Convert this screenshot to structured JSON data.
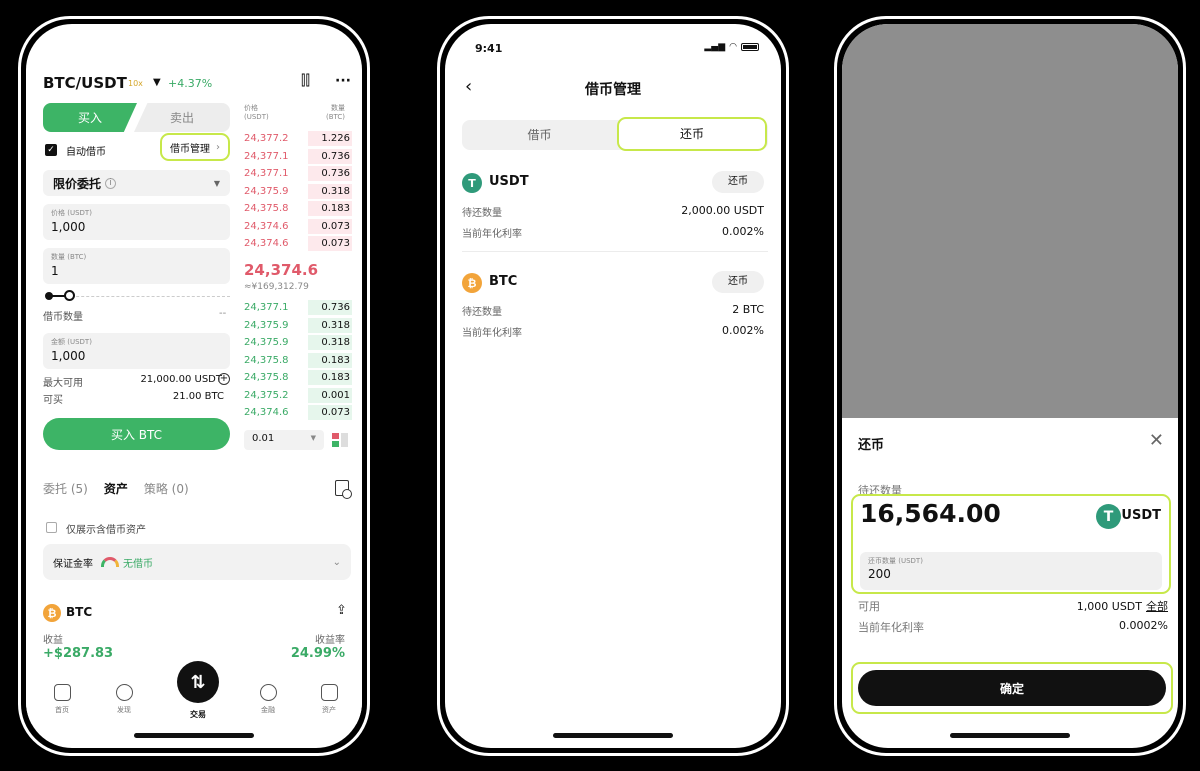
{
  "phone1": {
    "pair": "BTC/USDT",
    "leverage_badge": "10x",
    "change": "+4.37%",
    "buy_tab": "买入",
    "sell_tab": "卖出",
    "auto_borrow": "自动借币",
    "borrow_manage": "借币管理",
    "order_type": "限价委托",
    "price_label": "价格 (USDT)",
    "price_value": "1,000",
    "qty_label": "数量 (BTC)",
    "qty_value": "1",
    "borrow_qty": "借币数量",
    "borrow_qty_value": "--",
    "total_label": "金额 (USDT)",
    "total_value": "1,000",
    "max_avail_label": "最大可用",
    "max_avail_value": "21,000.00 USDT",
    "buyable_label": "可买",
    "buyable_value": "21.00 BTC",
    "buy_button": "买入 BTC",
    "ob_price_head": "价格\n(USDT)",
    "ob_qty_head": "数量\n(BTC)",
    "asks": [
      {
        "price": "24,377.2",
        "qty": "1.226"
      },
      {
        "price": "24,377.1",
        "qty": "0.736"
      },
      {
        "price": "24,377.1",
        "qty": "0.736"
      },
      {
        "price": "24,375.9",
        "qty": "0.318"
      },
      {
        "price": "24,375.8",
        "qty": "0.183"
      },
      {
        "price": "24,374.6",
        "qty": "0.073"
      },
      {
        "price": "24,374.6",
        "qty": "0.073"
      }
    ],
    "mid_price": "24,374.6",
    "mid_cny": "≈¥169,312.79",
    "bids": [
      {
        "price": "24,377.1",
        "qty": "0.736"
      },
      {
        "price": "24,375.9",
        "qty": "0.318"
      },
      {
        "price": "24,375.9",
        "qty": "0.318"
      },
      {
        "price": "24,375.8",
        "qty": "0.183"
      },
      {
        "price": "24,375.8",
        "qty": "0.183"
      },
      {
        "price": "24,375.2",
        "qty": "0.001"
      },
      {
        "price": "24,374.6",
        "qty": "0.073"
      }
    ],
    "tick_size": "0.01",
    "tabs": [
      "委托 (5)",
      "资产",
      "策略 (0)"
    ],
    "only_borrow": "仅展示含借币资产",
    "margin_label": "保证金率",
    "margin_status": "无借币",
    "asset_name": "BTC",
    "pnl_label": "收益",
    "pnl_value": "+$287.83",
    "pnl_rate_label": "收益率",
    "pnl_rate_value": "24.99%",
    "nav": [
      "首页",
      "发现",
      "交易",
      "金融",
      "资产"
    ]
  },
  "phone2": {
    "time": "9:41",
    "title": "借币管理",
    "seg_borrow": "借币",
    "seg_repay": "还币",
    "repay_btn": "还币",
    "due_label": "待还数量",
    "rate_label": "当前年化利率",
    "assets": [
      {
        "name": "USDT",
        "due": "2,000.00 USDT",
        "rate": "0.002%"
      },
      {
        "name": "BTC",
        "due": "2 BTC",
        "rate": "0.002%"
      }
    ]
  },
  "phone3": {
    "title": "还币",
    "due_label": "待还数量",
    "amount": "16,564.00",
    "unit": "USDT",
    "input_label": "还币数量 (USDT)",
    "input_value": "200",
    "avail_label": "可用",
    "avail_value": "1,000 USDT",
    "all_label": "全部",
    "rate_label": "当前年化利率",
    "rate_value": "0.0002%",
    "confirm": "确定"
  },
  "colors": {
    "buy_green": "#3db466",
    "ask_red": "#e05a6a",
    "highlight": "#c7e84a"
  }
}
